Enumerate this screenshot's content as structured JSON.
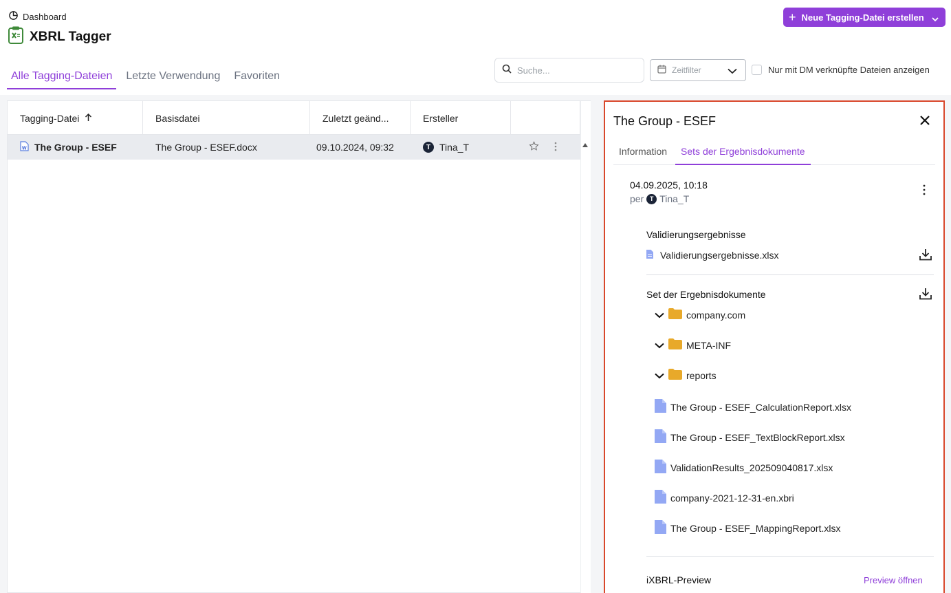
{
  "header": {
    "breadcrumb": "Dashboard",
    "app_title": "XBRL Tagger",
    "new_button_label": "Neue Tagging-Datei erstellen"
  },
  "tabs": [
    {
      "label": "Alle Tagging-Dateien",
      "active": true
    },
    {
      "label": "Letzte Verwendung",
      "active": false
    },
    {
      "label": "Favoriten",
      "active": false
    }
  ],
  "toolbar": {
    "search_placeholder": "Suche...",
    "time_filter_placeholder": "Zeitfilter",
    "dm_checkbox_label": "Nur mit DM verknüpfte Dateien anzeigen"
  },
  "table": {
    "columns": [
      "Tagging-Datei",
      "Basisdatei",
      "Zuletzt geänd...",
      "Ersteller"
    ],
    "rows": [
      {
        "name": "The Group - ESEF",
        "base": "The Group - ESEF.docx",
        "modified": "09.10.2024, 09:32",
        "creator_initial": "T",
        "creator": "Tina_T"
      }
    ]
  },
  "detail": {
    "title": "The Group - ESEF",
    "tabs": [
      {
        "label": "Information",
        "active": false
      },
      {
        "label": "Sets der Ergebnisdokumente",
        "active": true
      }
    ],
    "set_date": "04.09.2025, 10:18",
    "set_by_prefix": "per",
    "set_by_initial": "T",
    "set_by_user": "Tina_T",
    "validation_section": "Validierungsergebnisse",
    "validation_file": "Validierungsergebnisse.xlsx",
    "docset_section": "Set der Ergebnisdokumente",
    "folders": [
      "company.com",
      "META-INF",
      "reports"
    ],
    "files": [
      "The Group - ESEF_CalculationReport.xlsx",
      "The Group - ESEF_TextBlockReport.xlsx",
      "ValidationResults_202509040817.xlsx",
      "company-2021-12-31-en.xbri",
      "The Group - ESEF_MappingReport.xlsx"
    ],
    "preview_section": "iXBRL-Preview",
    "preview_link": "Preview öffnen"
  },
  "colors": {
    "accent": "#8f3fd9",
    "highlight_border": "#d9472b",
    "folder": "#e8a92a",
    "file": "#93a8f4"
  }
}
